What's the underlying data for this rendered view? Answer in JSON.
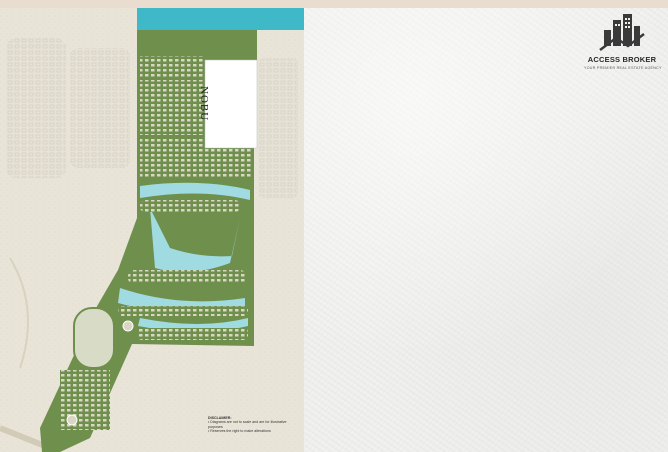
{
  "brand": {
    "name": "ACCESS BROKER",
    "tagline": "YOUR PREMIER REAL ESTATE AGENCY"
  },
  "map": {
    "plot_label": "NOBU",
    "disclaimer_title": "DISCLAIMER:",
    "disclaimer_lines": [
      "• Diagrams are not to scale and are for illustrative purposes",
      "• Reserves the right to make alterations"
    ]
  },
  "colors": {
    "sea": "#3fb8c7",
    "beach": "#e9d7b2",
    "desert": "#e8e3d6",
    "greenery": "#6f8f4d",
    "lagoon": "#9fdbe0",
    "paper": "#f1f1ef",
    "logo": "#3a3a3a"
  }
}
